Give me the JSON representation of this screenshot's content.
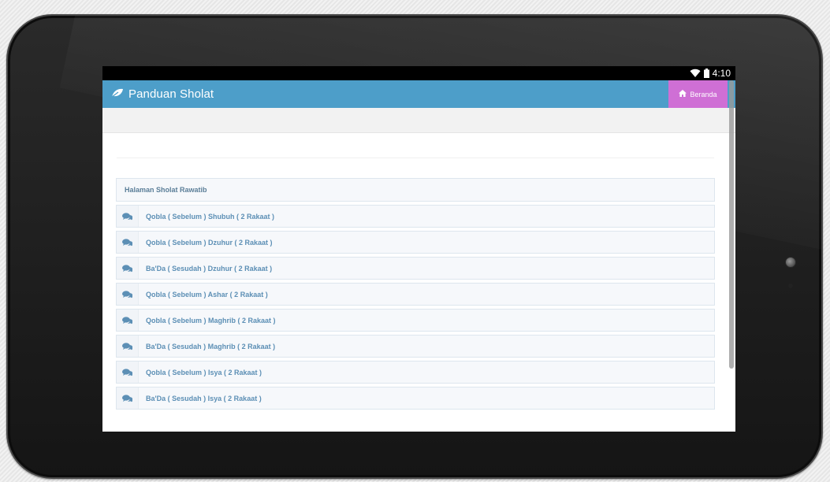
{
  "status_bar": {
    "time": "4:10"
  },
  "app": {
    "title": "Panduan Sholat",
    "home_button_label": "Beranda"
  },
  "list": {
    "heading": "Halaman Sholat Rawatib",
    "items": [
      {
        "label": "Qobla ( Sebelum ) Shubuh ( 2 Rakaat )"
      },
      {
        "label": "Qobla ( Sebelum ) Dzuhur ( 2 Rakaat )"
      },
      {
        "label": "Ba'Da ( Sesudah ) Dzuhur ( 2 Rakaat )"
      },
      {
        "label": "Qobla ( Sebelum ) Ashar ( 2 Rakaat )"
      },
      {
        "label": "Qobla ( Sebelum ) Maghrib ( 2 Rakaat )"
      },
      {
        "label": "Ba'Da ( Sesudah ) Maghrib ( 2 Rakaat )"
      },
      {
        "label": "Qobla ( Sebelum ) Isya ( 2 Rakaat )"
      },
      {
        "label": "Ba'Da ( Sesudah ) Isya ( 2 Rakaat )"
      }
    ]
  },
  "icons": {
    "app_logo": "leaf-icon",
    "home": "home-icon",
    "item": "comments-icon",
    "wifi": "wifi-icon",
    "battery": "battery-icon"
  },
  "colors": {
    "header": "#4d9ec9",
    "home_button": "#cf6fd5",
    "item_text": "#5c8fb5",
    "heading_text": "#5b7e98"
  }
}
